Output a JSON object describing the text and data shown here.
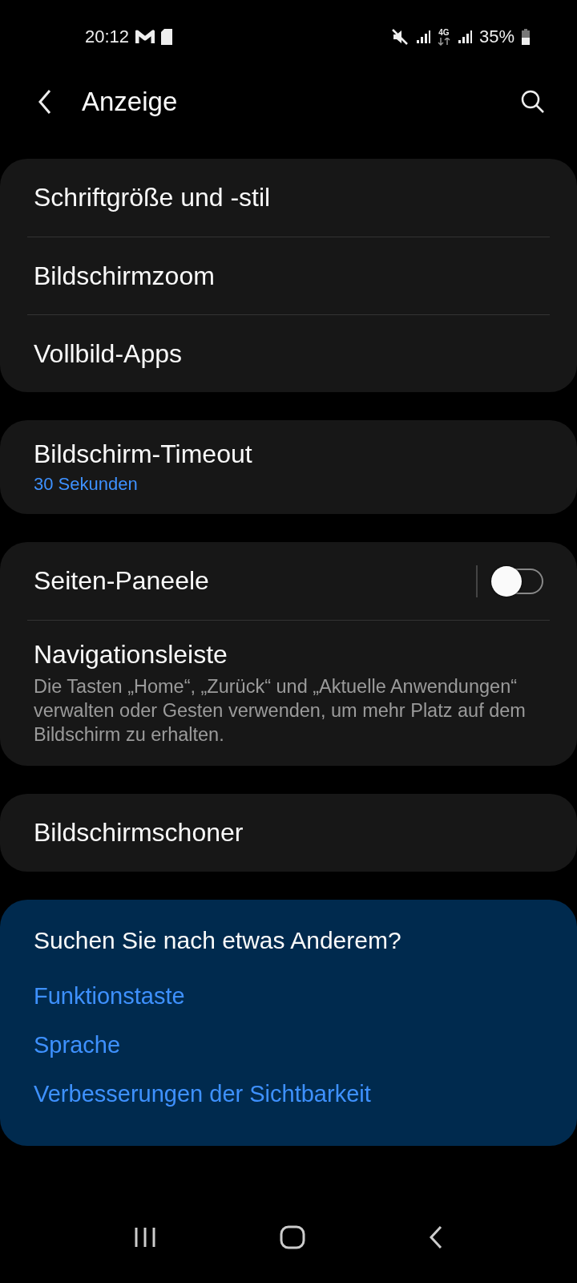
{
  "status_bar": {
    "time": "20:12",
    "network": "4G",
    "battery": "35%"
  },
  "header": {
    "title": "Anzeige"
  },
  "groups": [
    {
      "items": [
        {
          "kind": "plain",
          "title": "Schriftgröße und -stil"
        },
        {
          "kind": "plain",
          "title": "Bildschirmzoom"
        },
        {
          "kind": "plain",
          "title": "Vollbild-Apps"
        }
      ]
    },
    {
      "items": [
        {
          "kind": "summary",
          "title": "Bildschirm-Timeout",
          "summary": "30 Sekunden"
        }
      ]
    },
    {
      "items": [
        {
          "kind": "toggle",
          "title": "Seiten-Paneele",
          "on": false
        },
        {
          "kind": "description",
          "title": "Navigationsleiste",
          "description": "Die Tasten „Home“, „Zurück“ und „Aktuelle Anwendungen“ verwalten oder Gesten verwenden, um mehr Platz auf dem Bildschirm zu erhalten."
        }
      ]
    },
    {
      "items": [
        {
          "kind": "plain",
          "title": "Bildschirmschoner"
        }
      ]
    }
  ],
  "related": {
    "title": "Suchen Sie nach etwas Anderem?",
    "links": [
      "Funktionstaste",
      "Sprache",
      "Verbesserungen der Sichtbarkeit"
    ]
  }
}
